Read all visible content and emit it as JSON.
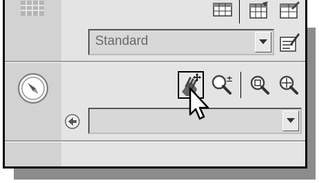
{
  "layer_properties": {
    "layer_dropdown": {
      "value": "Standard"
    }
  },
  "navigation": {
    "view_dropdown": {
      "value": ""
    }
  },
  "icons": {
    "grid": "grid-icon",
    "table": "table-icon",
    "table_edit1": "table-edit-icon",
    "table_edit2": "table-edit-icon",
    "dropdown_edit": "edit-pencil-icon",
    "compass": "compass-icon",
    "pan": "pan-hand-icon",
    "zoom_realtime": "zoom-realtime-icon",
    "zoom_window": "zoom-window-icon",
    "zoom_extents": "zoom-extents-icon",
    "back": "back-arrow-icon",
    "cursor": "mouse-cursor-icon"
  }
}
